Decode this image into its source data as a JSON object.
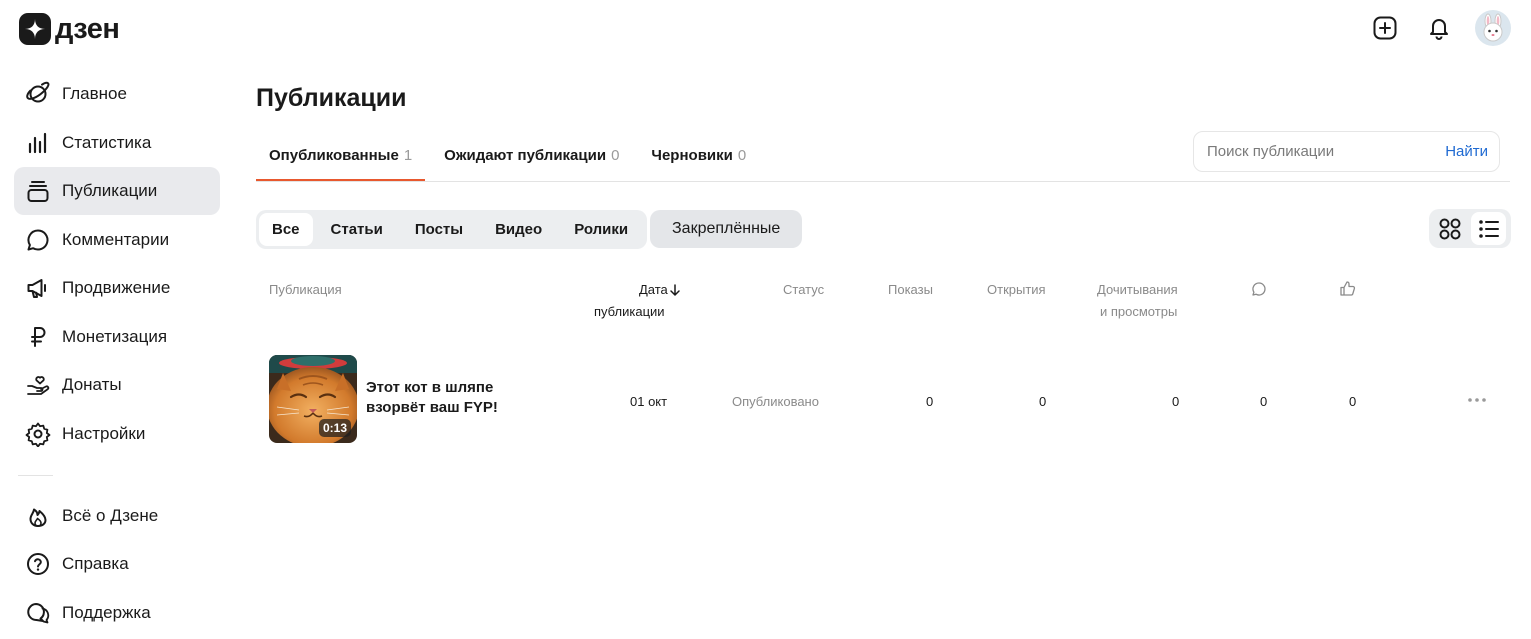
{
  "header": {
    "logo_text": "дзен",
    "icons": [
      "dzen-logo-icon",
      "add-icon",
      "bell-icon",
      "avatar-rabbit-icon"
    ]
  },
  "sidebar": {
    "items": [
      {
        "label": "Главное",
        "icon": "planet-icon"
      },
      {
        "label": "Статистика",
        "icon": "bar-chart-icon"
      },
      {
        "label": "Публикации",
        "icon": "publications-icon",
        "active": true
      },
      {
        "label": "Комментарии",
        "icon": "comment-icon"
      },
      {
        "label": "Продвижение",
        "icon": "megaphone-icon"
      },
      {
        "label": "Монетизация",
        "icon": "ruble-icon"
      },
      {
        "label": "Донаты",
        "icon": "donate-heart-icon"
      },
      {
        "label": "Настройки",
        "icon": "gear-icon"
      }
    ],
    "bottom_items": [
      {
        "label": "Всё о Дзене",
        "icon": "flame-icon"
      },
      {
        "label": "Справка",
        "icon": "help-icon"
      },
      {
        "label": "Поддержка",
        "icon": "support-chat-icon"
      }
    ]
  },
  "main": {
    "title": "Публикации",
    "tabs": [
      {
        "label": "Опубликованные",
        "count": "1",
        "active": true
      },
      {
        "label": "Ожидают публикации",
        "count": "0"
      },
      {
        "label": "Черновики",
        "count": "0"
      }
    ],
    "search": {
      "placeholder": "Поиск публикации",
      "button": "Найти"
    },
    "filters": [
      "Все",
      "Статьи",
      "Посты",
      "Видео",
      "Ролики"
    ],
    "pinned_label": "Закреплённые",
    "view_toggle": {
      "grid": "grid-view-icon",
      "list": "list-view-icon",
      "active": "list"
    }
  },
  "table": {
    "headers": {
      "publication": "Публикация",
      "date_line1": "Дата",
      "date_line2": "публикации",
      "status": "Статус",
      "views": "Показы",
      "opens": "Открытия",
      "reads_line1": "Дочитывания",
      "reads_line2": "и просмотры",
      "comments_icon": "comment-icon",
      "likes_icon": "like-icon"
    },
    "rows": [
      {
        "title": "Этот кот в шляпе взорвёт ваш FYP!",
        "duration": "0:13",
        "date": "01 окт",
        "status": "Опубликовано",
        "views": "0",
        "opens": "0",
        "reads": "0",
        "comments": "0",
        "likes": "0"
      }
    ]
  },
  "colors": {
    "accent": "#e8582e",
    "link": "#1f6ad2",
    "active_bg": "#e9eaed"
  }
}
